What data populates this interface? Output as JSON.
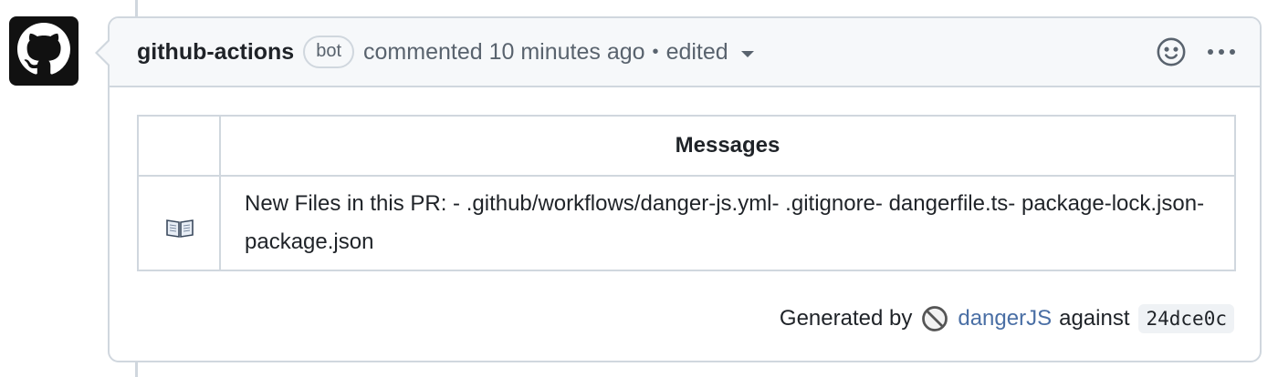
{
  "comment": {
    "author": "github-actions",
    "badge": "bot",
    "action": "commented 10 minutes ago",
    "separator": "•",
    "edited_label": "edited",
    "avatar_icon": "github-octocat-icon",
    "reaction_icon": "smiley-icon",
    "more_icon": "kebab-horizontal-icon"
  },
  "table": {
    "header_icon": "",
    "header_label": "Messages",
    "rows": [
      {
        "icon": "open-book-icon",
        "message": "New Files in this PR: - .github/workflows/danger-js.yml- .gitignore- dangerfile.ts- package-lock.json- package.json"
      }
    ]
  },
  "footer": {
    "generated_by": "Generated by",
    "tool_icon": "no-entry-icon",
    "tool_name": "dangerJS",
    "against": "against",
    "commit_sha": "24dce0c"
  },
  "colors": {
    "border": "#d0d7de",
    "header_bg": "#f6f8fa",
    "muted_text": "#59636e",
    "link": "#4a6fa5",
    "avatar_bg": "#111111"
  }
}
